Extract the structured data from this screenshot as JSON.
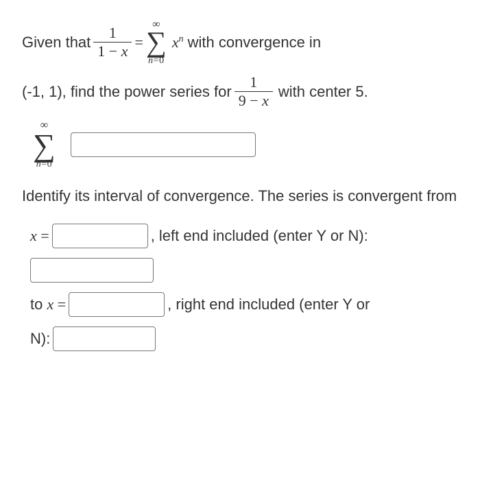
{
  "p1": {
    "t1": "Given that",
    "frac1_num": "1",
    "frac1_den_a": "1 − ",
    "frac1_den_x": "x",
    "eq": " = ",
    "sum_upper": "∞",
    "sum_sigma": "∑",
    "sum_lower_a": "n",
    "sum_lower_b": "=",
    "sum_lower_c": "0",
    "xn_x": "x",
    "xn_n": "n",
    "t2": " with convergence in"
  },
  "p2": {
    "t1": "(-1, 1), find the power series for ",
    "frac2_num": "1",
    "frac2_den_a": "9 − ",
    "frac2_den_x": "x",
    "t2": " with center 5."
  },
  "ans1": {
    "sum_upper": "∞",
    "sum_sigma": "∑",
    "sum_lower_a": "n",
    "sum_lower_b": "=",
    "sum_lower_c": "0"
  },
  "p3": {
    "text": "Identify its interval of convergence. The series is convergent from"
  },
  "row1": {
    "xlbl_x": "x",
    "xlbl_eq": " = ",
    "after": ", left end included (enter Y or N):"
  },
  "row2": {
    "to": "to ",
    "x": "x",
    "eq": " = ",
    "after": ", right end included (enter Y or"
  },
  "row3": {
    "n": "N):"
  }
}
